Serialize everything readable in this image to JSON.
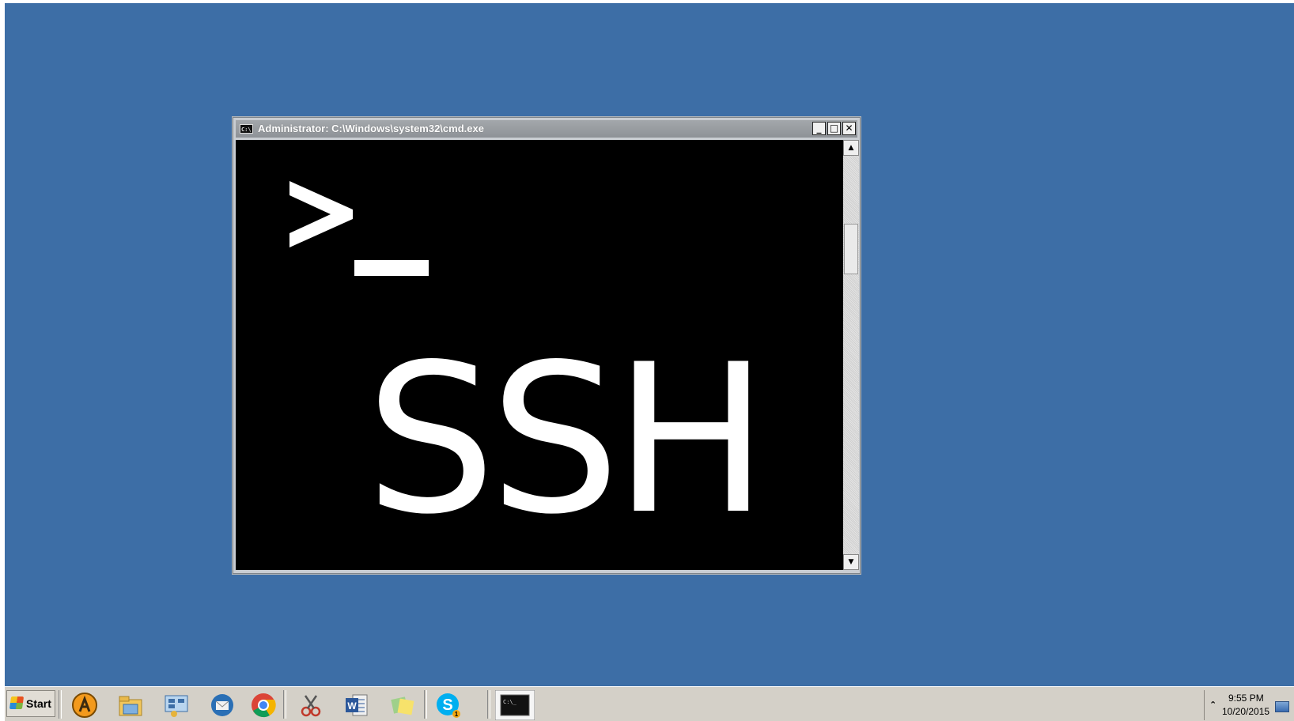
{
  "window": {
    "title": "Administrator: C:\\Windows\\system32\\cmd.exe",
    "icon_text": "C:\\",
    "minimize_glyph": "_",
    "maximize_glyph": "□",
    "close_glyph": "✕"
  },
  "console": {
    "graphic_text": "SSH"
  },
  "scrollbar": {
    "up_glyph": "▲",
    "down_glyph": "▼"
  },
  "taskbar": {
    "start_label": "Start",
    "pinned": [
      {
        "icon": "avast-icon"
      },
      {
        "icon": "file-explorer-icon"
      },
      {
        "icon": "server-manager-icon"
      },
      {
        "icon": "thunderbird-icon"
      },
      {
        "icon": "chrome-icon"
      },
      {
        "icon": "snipping-tool-icon"
      },
      {
        "icon": "word-icon"
      },
      {
        "icon": "sticky-notes-icon"
      },
      {
        "icon": "skype-icon"
      },
      {
        "icon": "command-prompt-icon"
      }
    ],
    "word_letter": "W",
    "skype_letter": "S",
    "skype_badge": "1",
    "cmd_icon_text": "C:\\_",
    "tray_chevron": "⌃",
    "clock_time": "9:55 PM",
    "clock_date": "10/20/2015"
  },
  "colors": {
    "desktop": "#3d6ea6",
    "console_bg": "#000000",
    "console_fg": "#ffffff",
    "taskbar": "#d4d0c8"
  }
}
